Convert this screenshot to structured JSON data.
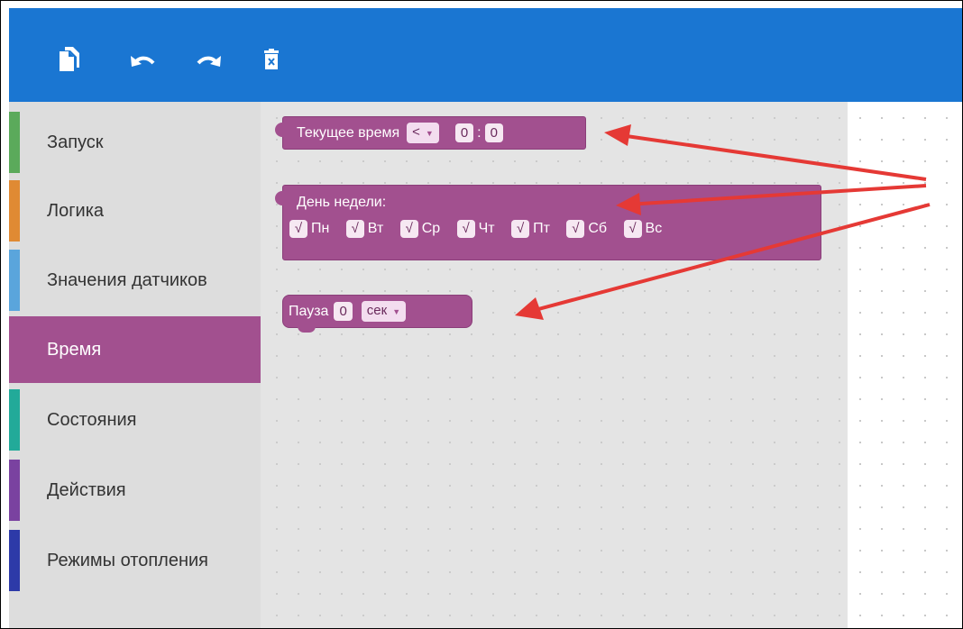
{
  "toolbar": {
    "icons": [
      "copy-icon",
      "undo-icon",
      "redo-icon",
      "delete-icon"
    ]
  },
  "sidebar": {
    "items": [
      {
        "label": "Запуск",
        "color": "#5baa5b"
      },
      {
        "label": "Логика",
        "color": "#e08a33"
      },
      {
        "label": "Значения датчиков",
        "color": "#5aa5dc"
      },
      {
        "label": "Время",
        "color": "#a2508f",
        "selected": true
      },
      {
        "label": "Состояния",
        "color": "#22aa99"
      },
      {
        "label": "Действия",
        "color": "#7a42a0"
      },
      {
        "label": "Режимы отопления",
        "color": "#2d3aa8"
      }
    ]
  },
  "blocks": {
    "current_time": {
      "label": "Текущее время",
      "operator": "<",
      "hours": "0",
      "separator": ":",
      "minutes": "0"
    },
    "weekday": {
      "label": "День недели:",
      "check_mark": "√",
      "days": [
        "Пн",
        "Вт",
        "Ср",
        "Чт",
        "Пт",
        "Сб",
        "Вс"
      ]
    },
    "pause": {
      "label": "Пауза",
      "value": "0",
      "unit": "сек"
    }
  },
  "colors": {
    "toolbar": "#1a76d2",
    "block": "#a2508f",
    "arrow": "#e53935",
    "sidebar_bg": "#dddddd",
    "workspace_bg": "#e4e4e4"
  }
}
